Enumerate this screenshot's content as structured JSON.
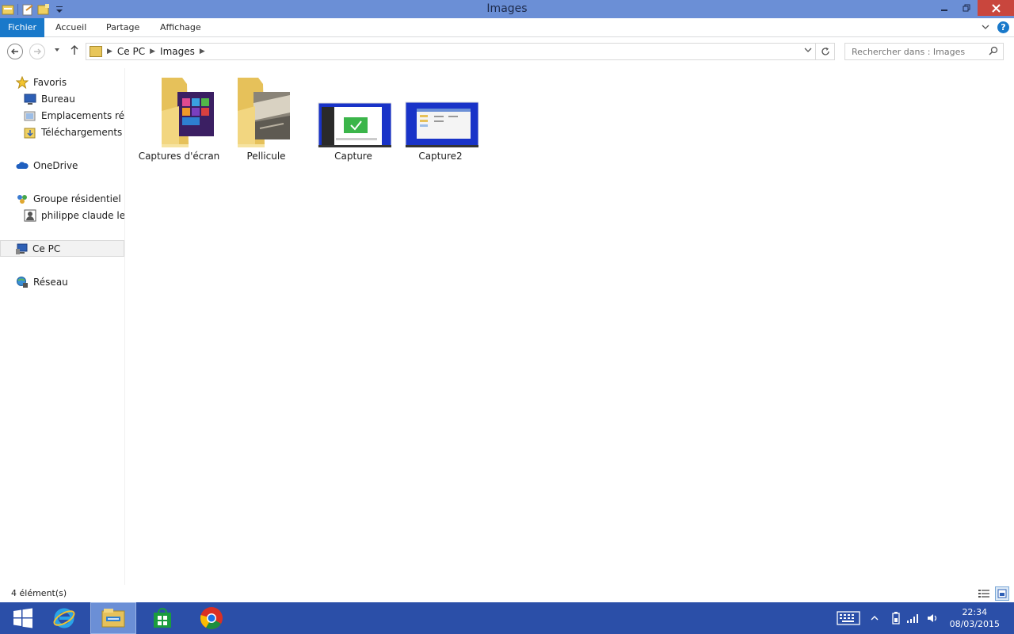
{
  "window": {
    "title": "Images"
  },
  "ribbon": {
    "tabs": [
      "Fichier",
      "Accueil",
      "Partage",
      "Affichage"
    ],
    "help": "?"
  },
  "address": {
    "crumbs": [
      "Ce PC",
      "Images"
    ],
    "search_placeholder": "Rechercher dans : Images"
  },
  "nav": {
    "items": [
      {
        "label": "Favoris",
        "icon": "star-icon"
      },
      {
        "label": "Bureau",
        "icon": "desktop-icon"
      },
      {
        "label": "Emplacements récen",
        "icon": "recent-places-icon"
      },
      {
        "label": "Téléchargements",
        "icon": "downloads-icon"
      },
      {
        "label": "OneDrive",
        "icon": "cloud-icon"
      },
      {
        "label": "Groupe résidentiel",
        "icon": "homegroup-icon"
      },
      {
        "label": "philippe claude legra",
        "icon": "user-icon"
      },
      {
        "label": "Ce PC",
        "icon": "computer-icon"
      },
      {
        "label": "Réseau",
        "icon": "network-icon"
      }
    ]
  },
  "files": [
    {
      "name": "Captures d'écran",
      "type": "folder"
    },
    {
      "name": "Pellicule",
      "type": "folder"
    },
    {
      "name": "Capture",
      "type": "image"
    },
    {
      "name": "Capture2",
      "type": "image"
    }
  ],
  "status": {
    "count": "4 élément(s)"
  },
  "taskbar": {
    "time": "22:34",
    "date": "08/03/2015"
  },
  "colors": {
    "titlebar": "#6b8fd6",
    "file_tab": "#1979ca",
    "taskbar": "#2b4fa8",
    "close": "#c9463d"
  }
}
